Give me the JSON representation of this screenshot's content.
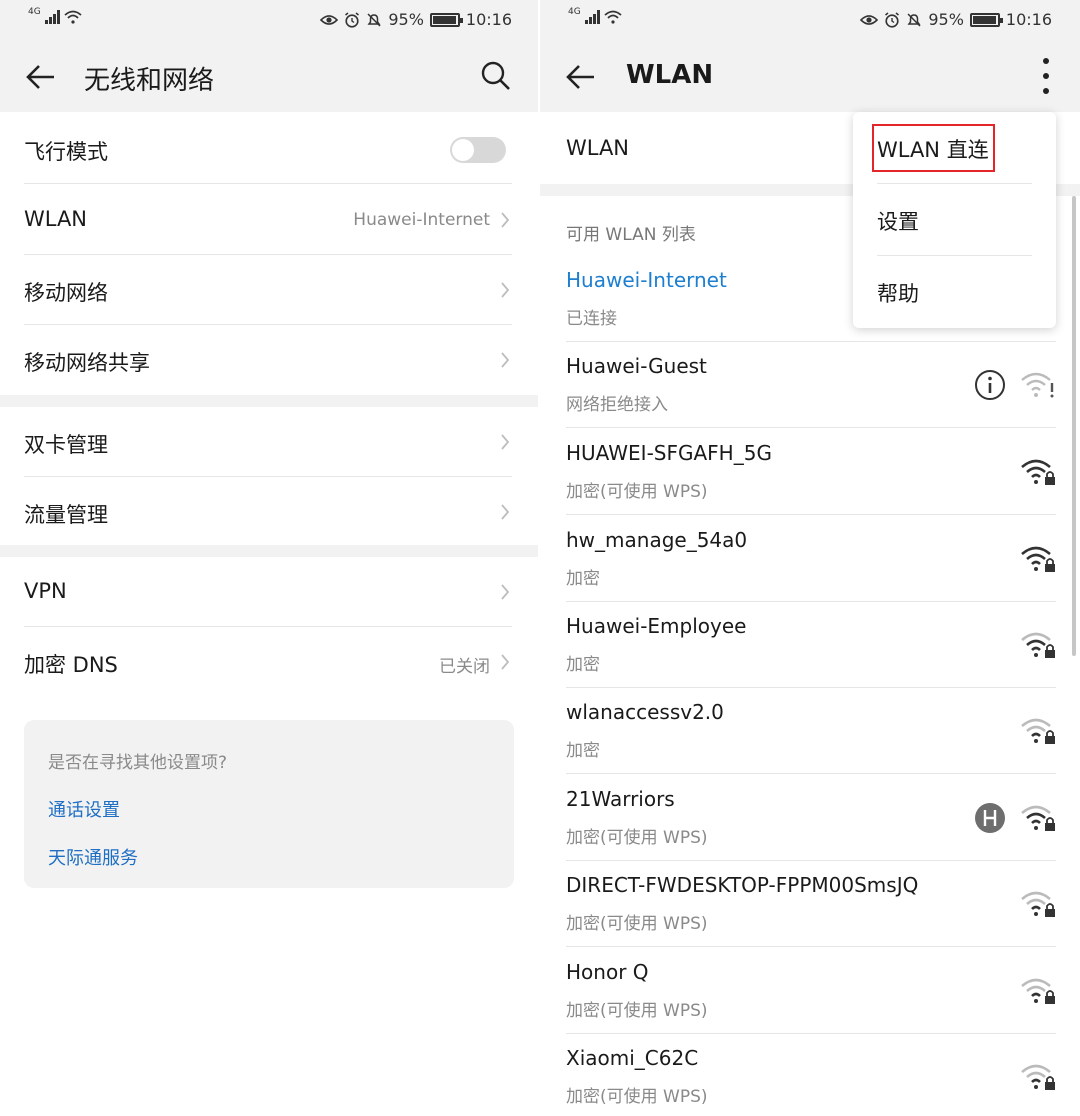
{
  "status": {
    "network_type": "4G",
    "battery": "95%",
    "time": "10:16"
  },
  "left": {
    "title": "无线和网络",
    "items": [
      {
        "label": "飞行模式",
        "value": ""
      },
      {
        "label": "WLAN",
        "value": "Huawei-Internet"
      },
      {
        "label": "移动网络",
        "value": ""
      },
      {
        "label": "移动网络共享",
        "value": ""
      },
      {
        "label": "双卡管理",
        "value": ""
      },
      {
        "label": "流量管理",
        "value": ""
      },
      {
        "label": "VPN",
        "value": ""
      },
      {
        "label": "加密 DNS",
        "value": "已关闭"
      }
    ],
    "suggest": {
      "question": "是否在寻找其他设置项?",
      "links": [
        "通话设置",
        "天际通服务"
      ]
    }
  },
  "right": {
    "title": "WLAN",
    "wlan_label": "WLAN",
    "section_title": "可用 WLAN 列表",
    "networks": [
      {
        "ssid": "Huawei-Internet",
        "sub": "已连接"
      },
      {
        "ssid": "Huawei-Guest",
        "sub": "网络拒绝接入"
      },
      {
        "ssid": "HUAWEI-SFGAFH_5G",
        "sub": "加密(可使用 WPS)"
      },
      {
        "ssid": "hw_manage_54a0",
        "sub": "加密"
      },
      {
        "ssid": "Huawei-Employee",
        "sub": "加密"
      },
      {
        "ssid": "wlanaccessv2.0",
        "sub": "加密"
      },
      {
        "ssid": "21Warriors",
        "sub": "加密(可使用 WPS)"
      },
      {
        "ssid": "DIRECT-FWDESKTOP-FPPM00SmsJQ",
        "sub": "加密(可使用 WPS)"
      },
      {
        "ssid": "Honor Q",
        "sub": "加密(可使用 WPS)"
      },
      {
        "ssid": "Xiaomi_C62C",
        "sub": "加密(可使用 WPS)"
      }
    ],
    "menu": [
      "WLAN 直连",
      "设置",
      "帮助"
    ]
  },
  "colors": {
    "link": "#1e6fc4",
    "connected": "#1e7fd0",
    "highlight_box": "#e5252a"
  }
}
